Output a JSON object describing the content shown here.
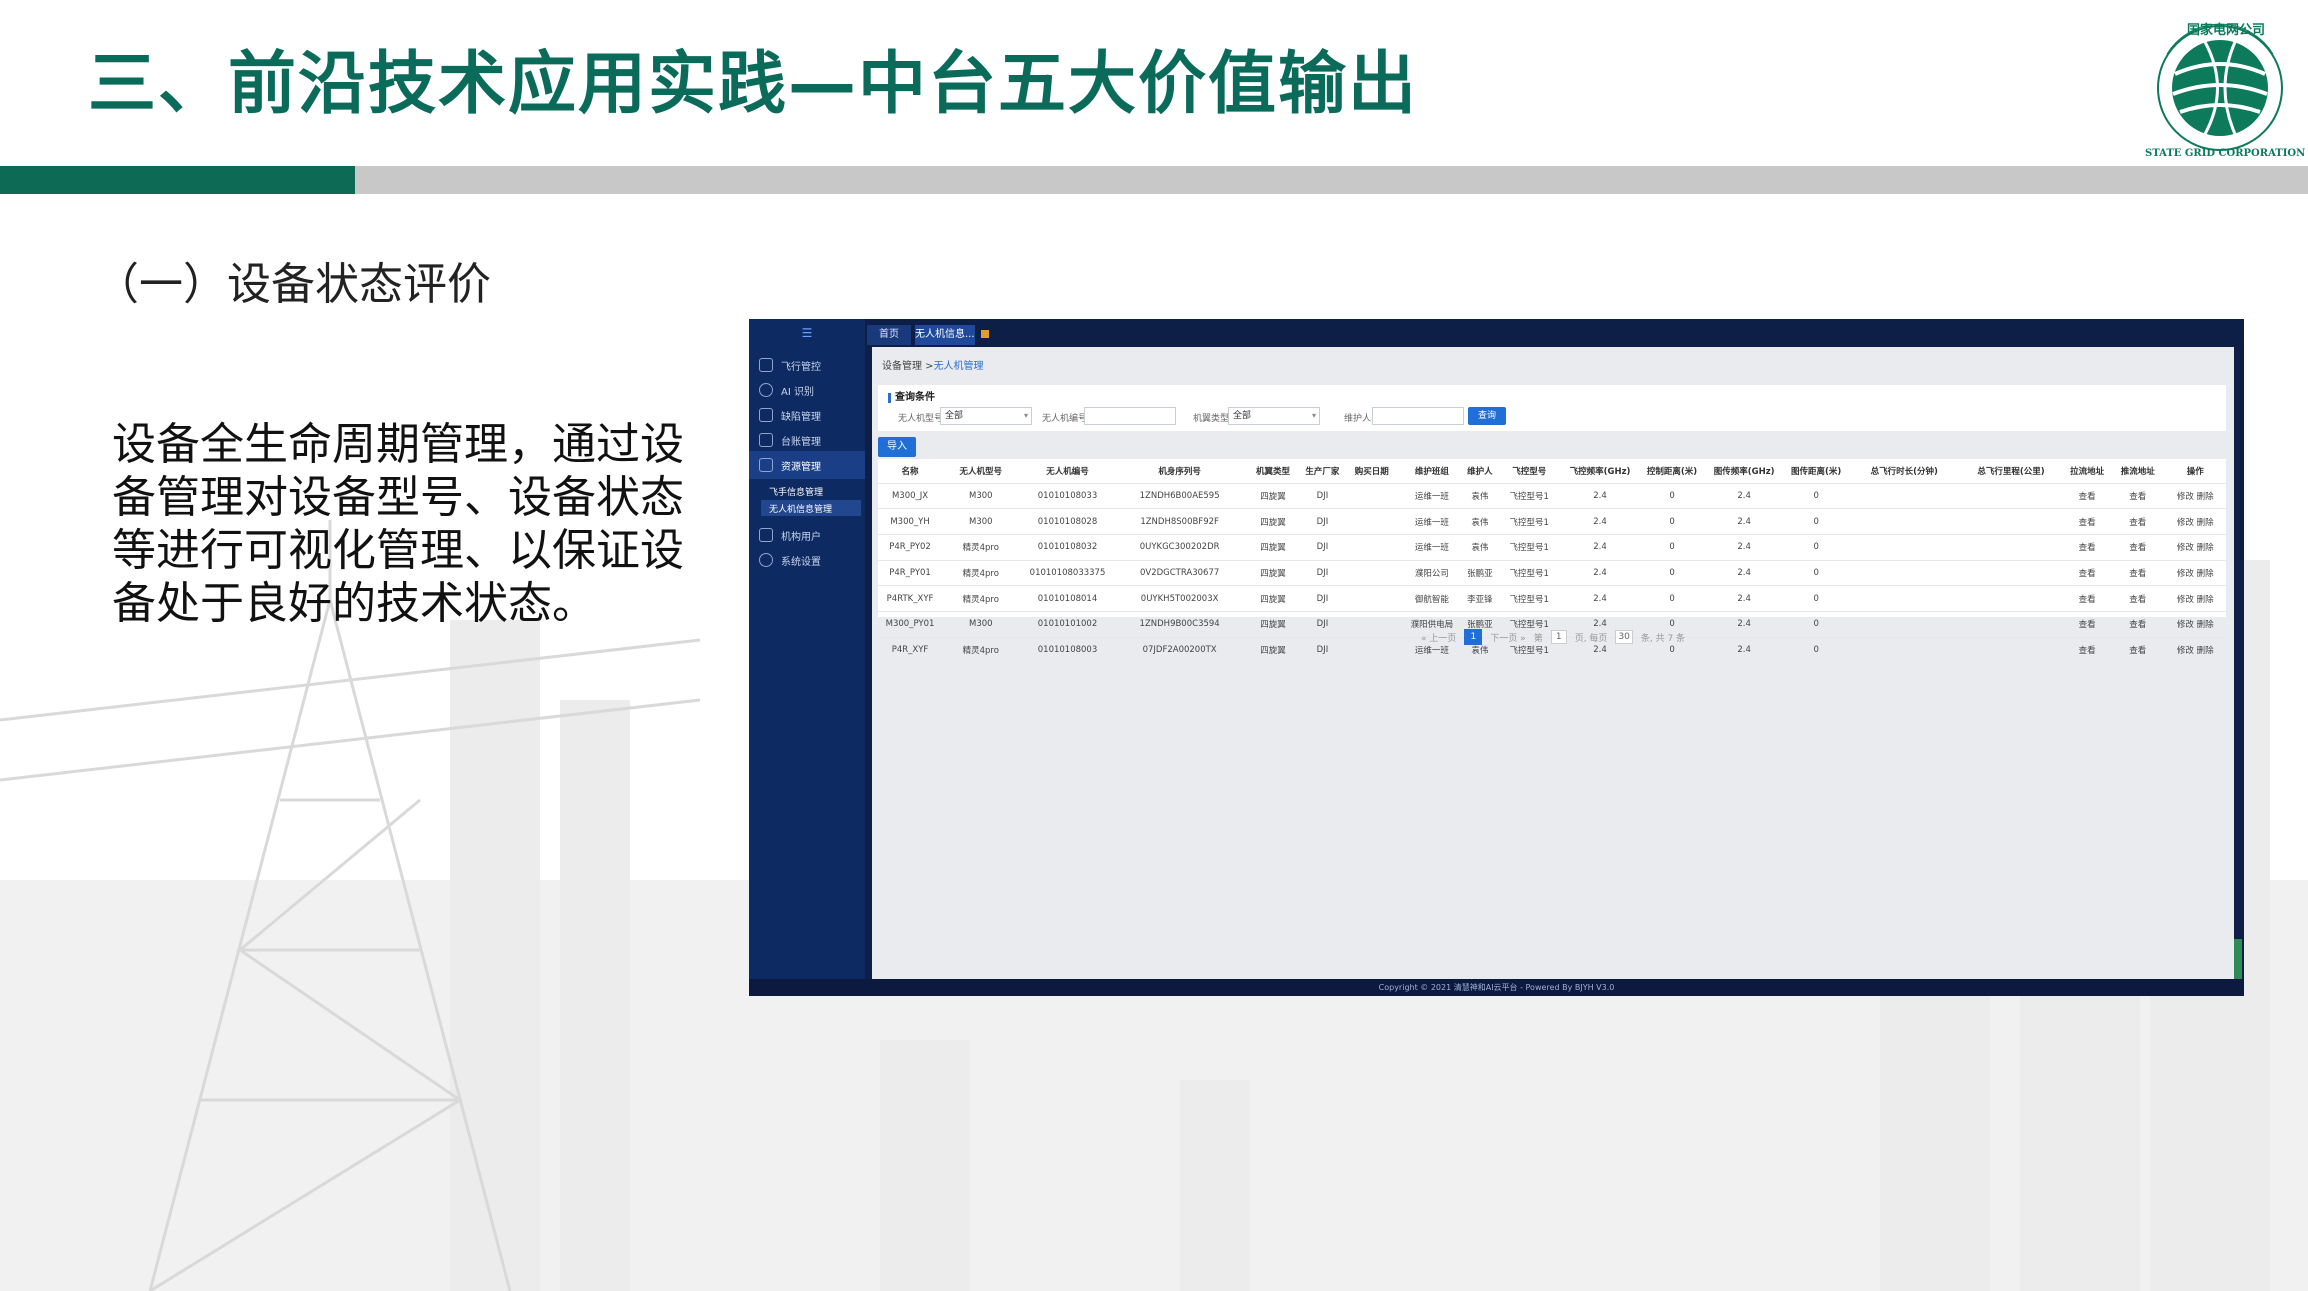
{
  "slide": {
    "title": "三、前沿技术应用实践—中台五大价值输出",
    "section_heading": "（一）设备状态评价",
    "body": "设备全生命周期管理，通过设备管理对设备型号、设备状态等进行可视化管理、以保证设备处于良好的技术状态。",
    "colors": {
      "title": "#0b6b5a",
      "accent_bar": "#0d6b55",
      "bar": "#c8c8c8"
    }
  },
  "logo": {
    "top_text": "国家电网公司",
    "ring_text": "STATE GRID CORPORATION OF CHINA"
  },
  "app": {
    "menu_icon": "menu-icon",
    "sidebar": [
      {
        "label": "飞行管控",
        "icon": "plane-icon"
      },
      {
        "label": "AI 识别",
        "icon": "ai-icon"
      },
      {
        "label": "缺陷管理",
        "icon": "defect-icon"
      },
      {
        "label": "台账管理",
        "icon": "ledger-icon"
      },
      {
        "label": "资源管理",
        "icon": "grid-icon"
      },
      {
        "label": "机构用户",
        "icon": "org-icon"
      },
      {
        "label": "系统设置",
        "icon": "gear-icon"
      }
    ],
    "sub_items": [
      "飞手信息管理",
      "无人机信息管理"
    ],
    "tabs": [
      "首页",
      "无人机信息..."
    ],
    "breadcrumb": {
      "parent": "设备管理",
      "sep": " >",
      "current": "无人机管理"
    },
    "query": {
      "title": "查询条件",
      "f1_label": "无人机型号:",
      "f1_value": "全部",
      "f2_label": "无人机编号:",
      "f2_value": "",
      "f3_label": "机翼类型:",
      "f3_value": "全部",
      "f4_label": "维护人:",
      "f4_value": "",
      "search": "查询"
    },
    "import_label": "导入",
    "columns": [
      "名称",
      "无人机型号",
      "无人机编号",
      "机身序列号",
      "机翼类型",
      "生产厂家",
      "购买日期",
      "维护班组",
      "维护人",
      "飞控型号",
      "飞控频率(GHz)",
      "控制距离(米)",
      "图传频率(GHz)",
      "图传距离(米)",
      "总飞行时长(分钟)",
      "总飞行里程(公里)",
      "拉流地址",
      "推流地址",
      "操作"
    ],
    "rows": [
      [
        "M300_JX",
        "M300",
        "01010108033",
        "1ZNDH6B00AE595",
        "四旋翼",
        "DJI",
        "",
        "运维一班",
        "袁伟",
        "飞控型号1",
        "2.4",
        "0",
        "2.4",
        "0",
        "",
        "",
        "查看",
        "查看",
        "修改 删除"
      ],
      [
        "M300_YH",
        "M300",
        "01010108028",
        "1ZNDH8S00BF92F",
        "四旋翼",
        "DJI",
        "",
        "运维一班",
        "袁伟",
        "飞控型号1",
        "2.4",
        "0",
        "2.4",
        "0",
        "",
        "",
        "查看",
        "查看",
        "修改 删除"
      ],
      [
        "P4R_PY02",
        "精灵4pro",
        "01010108032",
        "0UYKGC300202DR",
        "四旋翼",
        "DJI",
        "",
        "运维一班",
        "袁伟",
        "飞控型号1",
        "2.4",
        "0",
        "2.4",
        "0",
        "",
        "",
        "查看",
        "查看",
        "修改 删除"
      ],
      [
        "P4R_PY01",
        "精灵4pro",
        "01010108033375",
        "0V2DGCTRA30677",
        "四旋翼",
        "DJI",
        "",
        "濮阳公司",
        "张鹏亚",
        "飞控型号1",
        "2.4",
        "0",
        "2.4",
        "0",
        "",
        "",
        "查看",
        "查看",
        "修改 删除"
      ],
      [
        "P4RTK_XYF",
        "精灵4pro",
        "01010108014",
        "0UYKH5T002003X",
        "四旋翼",
        "DJI",
        "",
        "御航智能",
        "李亚锋",
        "飞控型号1",
        "2.4",
        "0",
        "2.4",
        "0",
        "",
        "",
        "查看",
        "查看",
        "修改 删除"
      ],
      [
        "M300_PY01",
        "M300",
        "01010101002",
        "1ZNDH9B00C3594",
        "四旋翼",
        "DJI",
        "",
        "濮阳供电局",
        "张鹏亚",
        "飞控型号1",
        "2.4",
        "0",
        "2.4",
        "0",
        "",
        "",
        "查看",
        "查看",
        "修改 删除"
      ],
      [
        "P4R_XYF",
        "精灵4pro",
        "01010108003",
        "07JDF2A00200TX",
        "四旋翼",
        "DJI",
        "",
        "运维一班",
        "袁伟",
        "飞控型号1",
        "2.4",
        "0",
        "2.4",
        "0",
        "",
        "",
        "查看",
        "查看",
        "修改 删除"
      ]
    ],
    "pager": {
      "prev": "« 上一页",
      "current": "1",
      "next": "下一页 »",
      "goto_prefix": "第",
      "goto_value": "1",
      "goto_mid": "页, 每页",
      "per_page": "30",
      "total": "条, 共 7 条"
    },
    "footer": "Copyright © 2021 清慧神和AI云平台 - Powered By BJYH V3.0"
  }
}
